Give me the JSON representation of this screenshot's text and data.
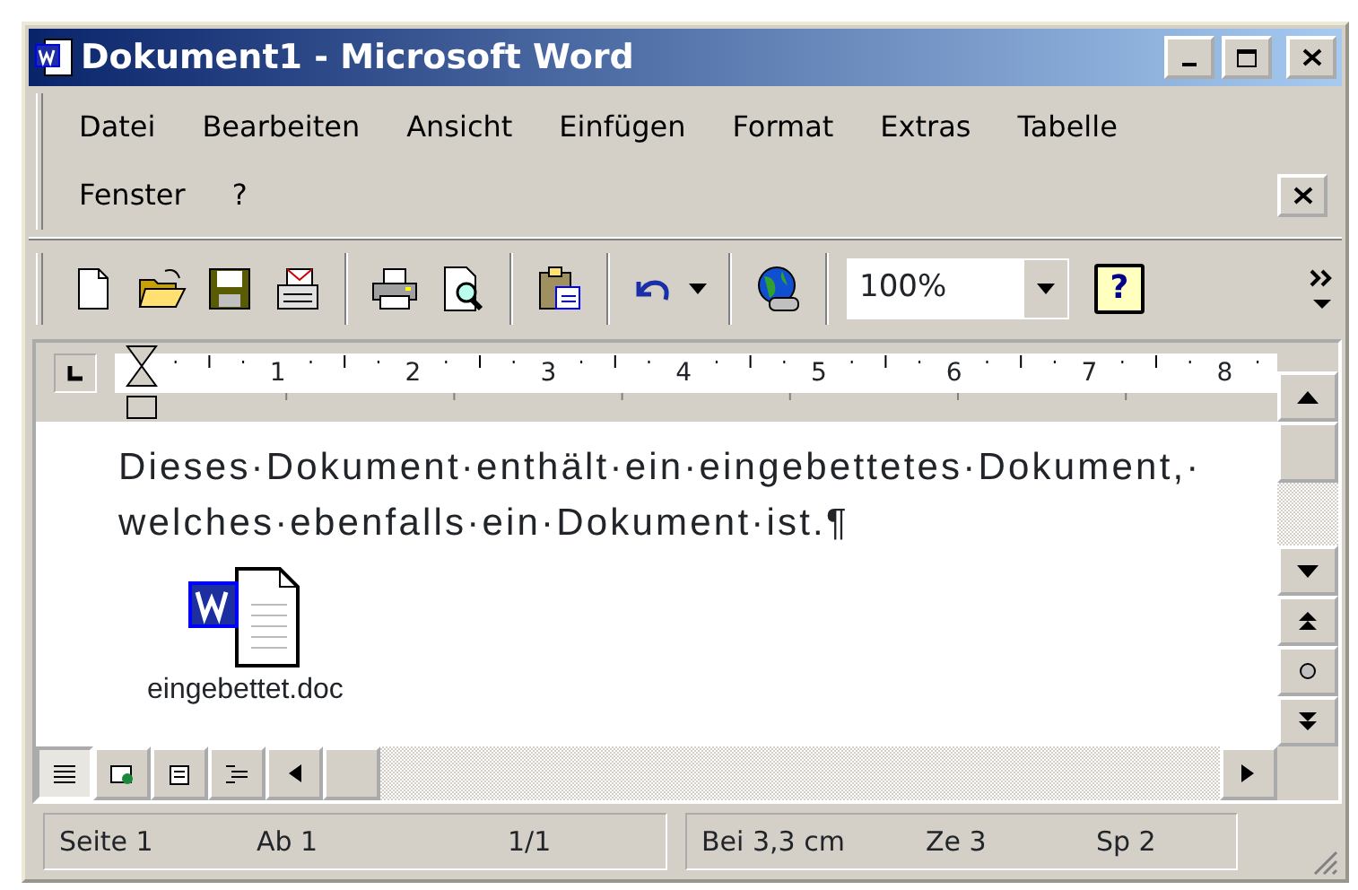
{
  "window": {
    "title": "Dokument1 - Microsoft Word"
  },
  "menu_rows": [
    [
      "Datei",
      "Bearbeiten",
      "Ansicht",
      "Einfügen",
      "Format",
      "Extras",
      "Tabelle"
    ],
    [
      "Fenster",
      "?"
    ]
  ],
  "toolbar": {
    "zoom": "100%",
    "help_glyph": "?"
  },
  "ruler": {
    "labels": [
      "1",
      "2",
      "3",
      "4",
      "5",
      "6",
      "7",
      "8"
    ]
  },
  "document": {
    "lines": [
      "Dieses·Dokument·enthält·ein·eingebettetes·Dokument,·",
      "welches·ebenfalls·ein·Dokument·ist.¶"
    ],
    "embedded_object": {
      "label": "eingebettet.doc"
    }
  },
  "view_buttons": [
    {
      "kind": "normal",
      "selected": true
    },
    {
      "kind": "web",
      "selected": false
    },
    {
      "kind": "print",
      "selected": false
    },
    {
      "kind": "outline",
      "selected": false
    }
  ],
  "status_bar": {
    "groups": [
      [
        "Seite 1",
        "Ab 1",
        "1/1"
      ],
      [
        "Bei 3,3 cm",
        "Ze 3",
        "Sp 2"
      ]
    ]
  }
}
